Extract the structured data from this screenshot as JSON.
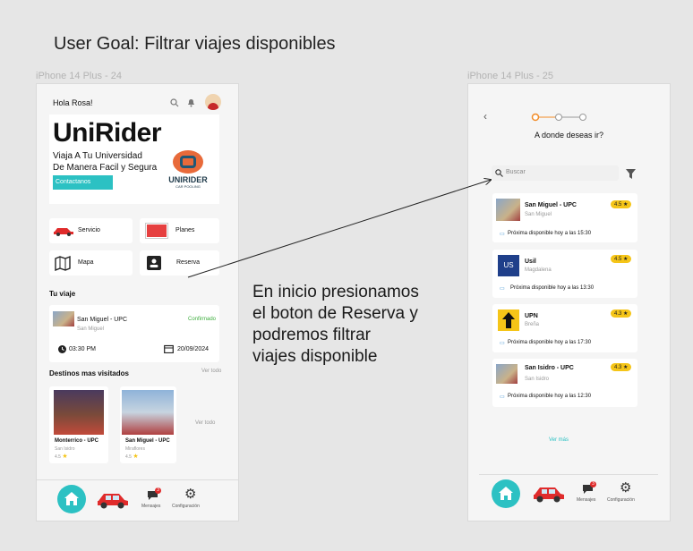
{
  "goal": "User Goal: Filtrar viajes disponibles",
  "frames": {
    "left_label": "iPhone 14 Plus - 24",
    "right_label": "iPhone 14 Plus - 25"
  },
  "annotation": {
    "lines": [
      "En inicio presionamos",
      "el boton de Reserva y",
      "podremos filtrar",
      "viajes disponible"
    ]
  },
  "home": {
    "greeting": "Hola Rosa!",
    "brand": "UniRider",
    "tagline_1": "Viaja A Tu Universidad",
    "tagline_2": "De Manera Facil y Segura",
    "contact_button": "Contactanos",
    "logo_text": "UNIRIDER",
    "logo_sub": "CAR POOLING",
    "menu": {
      "servicio": "Servicio",
      "planes": "Planes",
      "mapa": "Mapa",
      "reserva": "Reserva"
    },
    "trip_section": "Tu viaje",
    "trip": {
      "title": "San Miguel - UPC",
      "subtitle": "San Miguel",
      "status": "Confirmado",
      "time": "03:30 PM",
      "date": "20/09/2024"
    },
    "destinations_section": "Destinos mas visitados",
    "see_all_top": "Ver todo",
    "see_all_side": "Ver todo",
    "destinations": [
      {
        "title": "Monterrico - UPC",
        "subtitle": "San Isidro",
        "rating": "4.5"
      },
      {
        "title": "San Miguel - UPC",
        "subtitle": "Miraflores",
        "rating": "4.5"
      }
    ],
    "nav": {
      "messages": "Mensajes",
      "messages_badge": "3",
      "settings": "Configuración"
    }
  },
  "search_screen": {
    "question": "A donde deseas ir?",
    "search_placeholder": "Buscar",
    "results": [
      {
        "title": "San Miguel - UPC",
        "subtitle": "San Miguel",
        "rating": "4.5",
        "availability": "Próxima disponible hoy a las 15:30"
      },
      {
        "title": "Usil",
        "subtitle": "Magdalena",
        "rating": "4.5",
        "availability": "Próxima disponible hoy a las 13:30"
      },
      {
        "title": "UPN",
        "subtitle": "Breña",
        "rating": "4.3",
        "availability": "Próxima disponible hoy a las 17:30"
      },
      {
        "title": "San Isidro - UPC",
        "subtitle": "San Isidro",
        "rating": "4.3",
        "availability": "Próxima disponible hoy a las 12:30"
      }
    ],
    "see_more": "Ver más",
    "nav": {
      "messages": "Mensajes",
      "messages_badge": "3",
      "settings": "Configuración"
    }
  },
  "colors": {
    "accent": "#2cc1c3",
    "orange": "#f28c28",
    "rating": "#f5c518",
    "car": "#e02b2b",
    "status": "#3fae3f"
  }
}
